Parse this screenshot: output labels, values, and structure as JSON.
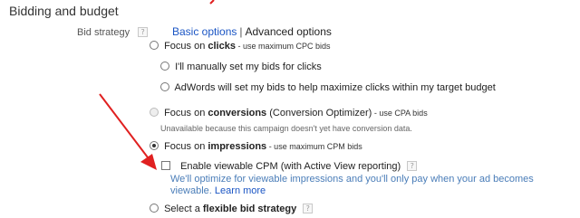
{
  "section_title": "Bidding and budget",
  "bid_strategy": {
    "label": "Bid strategy",
    "help_glyph": "?",
    "basic_options": "Basic options",
    "separator": "|",
    "advanced_options": "Advanced options"
  },
  "options": {
    "clicks": {
      "prefix": "Focus on ",
      "keyword": "clicks",
      "suffix": " - use maximum CPC bids",
      "selected": false
    },
    "manual_clicks": {
      "label": "I'll manually set my bids for clicks",
      "selected": false
    },
    "auto_clicks": {
      "label": "AdWords will set my bids to help maximize clicks within my target budget",
      "selected": false
    },
    "conversions": {
      "prefix": "Focus on ",
      "keyword": "conversions",
      "middle": " (Conversion Optimizer)",
      "suffix": " - use CPA bids",
      "note": "Unavailable because this campaign doesn't yet have conversion data.",
      "disabled": true
    },
    "impressions": {
      "prefix": "Focus on ",
      "keyword": "impressions",
      "suffix": " - use maximum CPM bids",
      "selected": true
    },
    "viewable_cpm": {
      "label": "Enable viewable CPM (with Active View reporting)",
      "checked": false,
      "help_glyph": "?",
      "description": "We'll optimize for viewable impressions and you'll only pay when your ad becomes viewable. ",
      "learn_more": "Learn more"
    },
    "flexible": {
      "prefix": "Select a ",
      "keyword": "flexible bid strategy",
      "help_glyph": "?",
      "selected": false
    }
  },
  "annotation": {
    "arrow_color": "#e02020"
  }
}
